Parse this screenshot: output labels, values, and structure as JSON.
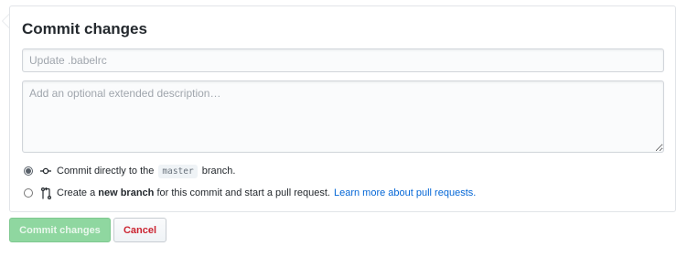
{
  "form": {
    "title": "Commit changes",
    "summary_placeholder": "Update .babelrc",
    "summary_value": "",
    "description_placeholder": "Add an optional extended description…",
    "description_value": ""
  },
  "options": {
    "direct": {
      "selected": true,
      "icon": "git-commit-icon",
      "text_before": "Commit directly to the",
      "branch": "master",
      "text_after": "branch."
    },
    "new_branch": {
      "selected": false,
      "icon": "git-pull-request-icon",
      "text_before": "Create a",
      "bold": "new branch",
      "text_after": "for this commit and start a pull request.",
      "link": "Learn more about pull requests."
    }
  },
  "buttons": {
    "commit_label": "Commit changes",
    "cancel_label": "Cancel"
  },
  "colors": {
    "commit_button_bg": "#8fd7a0",
    "cancel_text": "#cb2431",
    "link": "#0366d6"
  }
}
